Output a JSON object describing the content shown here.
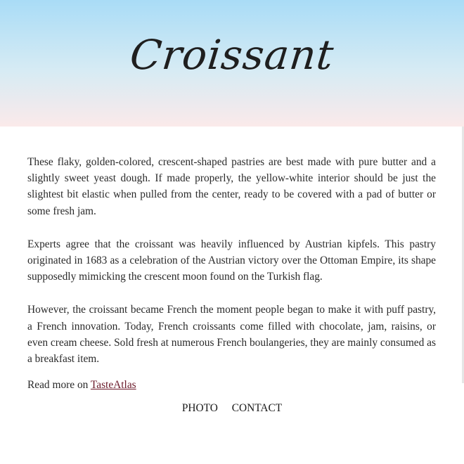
{
  "header": {
    "title": "Croissant"
  },
  "article": {
    "paragraphs": [
      "These flaky, golden-colored, crescent-shaped pastries are best made with pure butter and a slightly sweet yeast dough. If made properly, the yellow-white interior should be just the slightest bit elastic when pulled from the center, ready to be covered with a pad of butter or some fresh jam.",
      "Experts agree that the croissant was heavily influenced by Austrian kipfels. This pastry originated in 1683 as a celebration of the Austrian victory over the Ottoman Empire, its shape supposedly mimicking the crescent moon found on the Turkish flag.",
      "However, the croissant became French the moment people began to make it with puff pastry, a French innovation. Today, French croissants come filled with chocolate, jam, raisins, or even cream cheese. Sold fresh at numerous French boulangeries, they are mainly consumed as a breakfast item."
    ],
    "source_prefix": "Read more on ",
    "source_link": "TasteAtlas"
  },
  "nav": {
    "photo": "PHOTO",
    "contact": "CONTACT"
  },
  "colors": {
    "hero_top": "#a9dcf6",
    "hero_bottom": "#fbeaea",
    "link": "#6b1a2a"
  }
}
